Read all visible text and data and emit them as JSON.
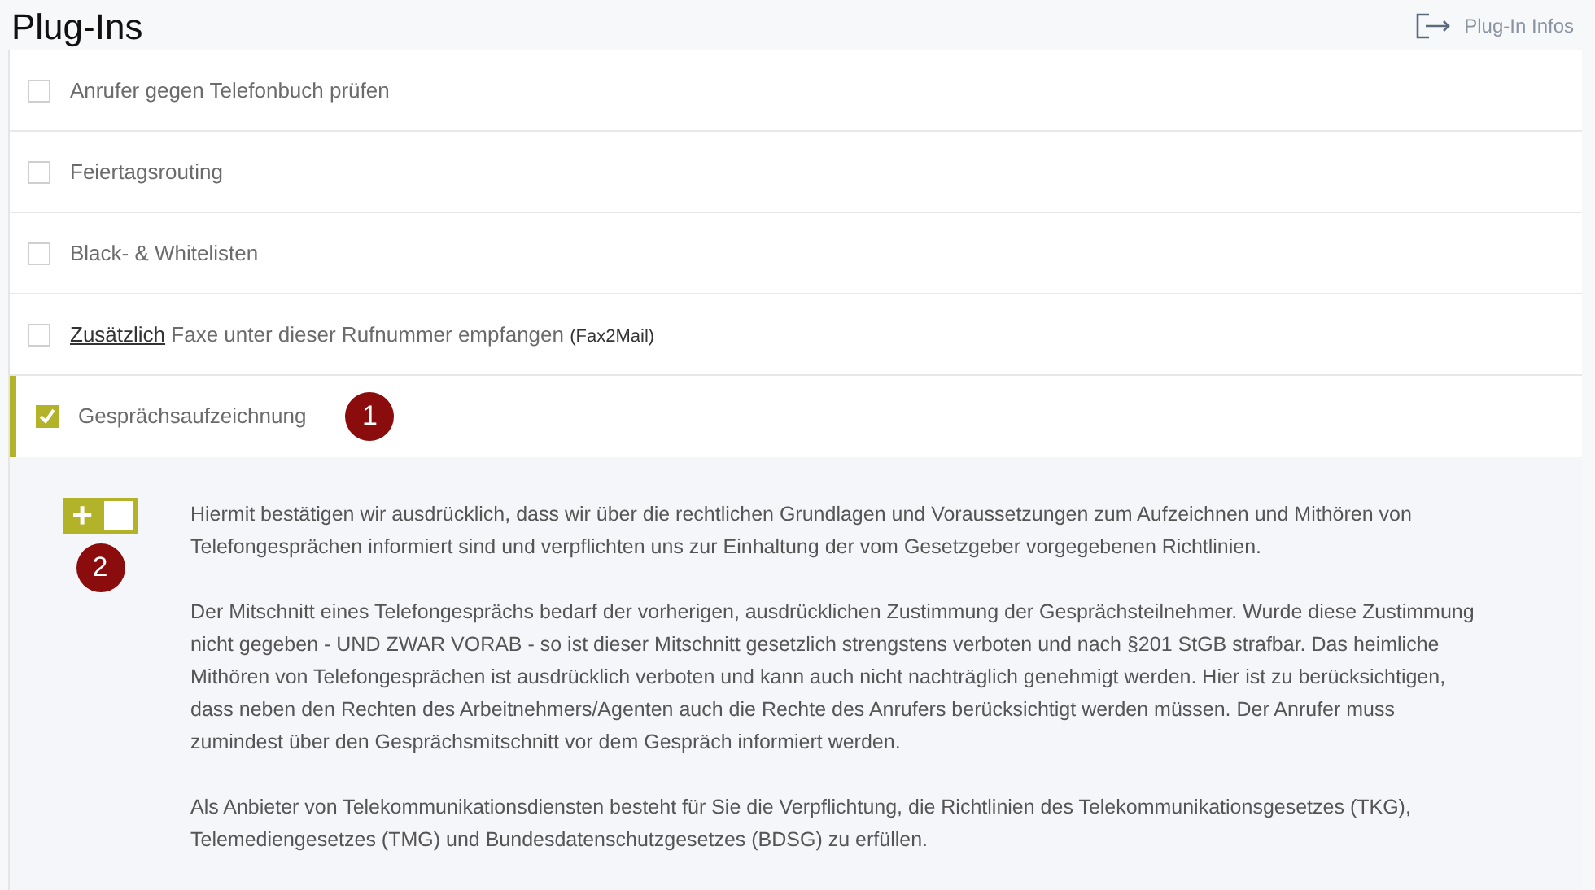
{
  "title": "Plug-Ins",
  "info_link": "Plug-In Infos",
  "plugins": [
    {
      "kind": "plain",
      "text": "Anrufer gegen Telefonbuch prüfen",
      "checked": false,
      "expanded": false
    },
    {
      "kind": "plain",
      "text": "Feiertagsrouting",
      "checked": false,
      "expanded": false
    },
    {
      "kind": "plain",
      "text": "Black- & Whitelisten",
      "checked": false,
      "expanded": false
    },
    {
      "kind": "link",
      "link": "Zusätzlich",
      "text": "Faxe unter dieser Rufnummer empfangen",
      "suffix": "(Fax2Mail)",
      "checked": false,
      "expanded": false
    },
    {
      "kind": "plain",
      "text": "Gesprächsaufzeichnung",
      "checked": true,
      "expanded": true,
      "callout": "1"
    }
  ],
  "details": {
    "toggle": {
      "on": true,
      "glyph": "+"
    },
    "callout": "2",
    "paragraphs": [
      "Hiermit bestätigen wir ausdrücklich, dass wir über die rechtlichen Grundlagen und Voraussetzungen zum Aufzeichnen und Mithören von Telefongesprächen informiert sind und verpflichten uns zur Einhaltung der vom Gesetzgeber vorgegebenen Richtlinien.",
      "Der Mitschnitt eines Telefongesprächs bedarf der vorherigen, ausdrücklichen Zustimmung der Gesprächsteilnehmer. Wurde diese Zustimmung nicht gegeben - UND ZWAR VORAB - so ist dieser Mitschnitt gesetzlich strengstens verboten und nach §201 StGB strafbar. Das heimliche Mithören von Telefongesprächen ist ausdrücklich verboten und kann auch nicht nachträglich genehmigt werden. Hier ist zu berücksichtigen, dass neben den Rechten des Arbeitnehmers/Agenten auch die Rechte des Anrufers berücksichtigt werden müssen. Der Anrufer muss zumindest über den Gesprächsmitschnitt vor dem Gespräch informiert werden.",
      "Als Anbieter von Telekommunikationsdiensten besteht für Sie die Verpflichtung, die Richtlinien des Telekommunikationsgesetzes (TKG), Telemediengesetzes (TMG) und Bundesdatenschutzgesetzes (BDSG) zu erfüllen."
    ]
  }
}
